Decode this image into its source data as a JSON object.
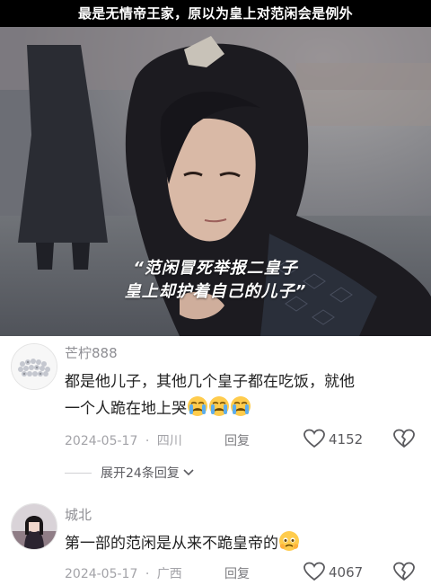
{
  "banner": {
    "title": "最是无情帝王家，原以为皇上对范闲会是例外"
  },
  "video": {
    "subtitle_line1": "“范闲冒死举报二皇子",
    "subtitle_line2": "皇上却护着自己的儿子”"
  },
  "comments": [
    {
      "username": "芒柠888",
      "text_line1": "都是他儿子，其他几个皇子都在吃饭，就他",
      "text_line2": "一个人跪在地上哭",
      "emoji": "loudly-crying-face",
      "emoji_count": 3,
      "date": "2024-05-17",
      "location": "四川",
      "separator": "·",
      "reply_label": "回复",
      "likes": "4152"
    },
    {
      "username": "城北",
      "text_line1": "第一部的范闲是从来不跪皇帝的",
      "emoji": "face-holding-back-tears",
      "date": "2024-05-17",
      "location": "广西",
      "separator": "·",
      "reply_label": "回复",
      "likes": "4067"
    }
  ],
  "expand": {
    "label": "展开24条回复",
    "icon": "chevron-down-icon"
  },
  "icons": {
    "like": "heart-outline-icon",
    "dislike": "broken-heart-icon"
  },
  "colors": {
    "text_primary": "#222222",
    "text_secondary": "#a3a3a8",
    "username": "#8e8e93",
    "banner_bg": "#000000"
  }
}
